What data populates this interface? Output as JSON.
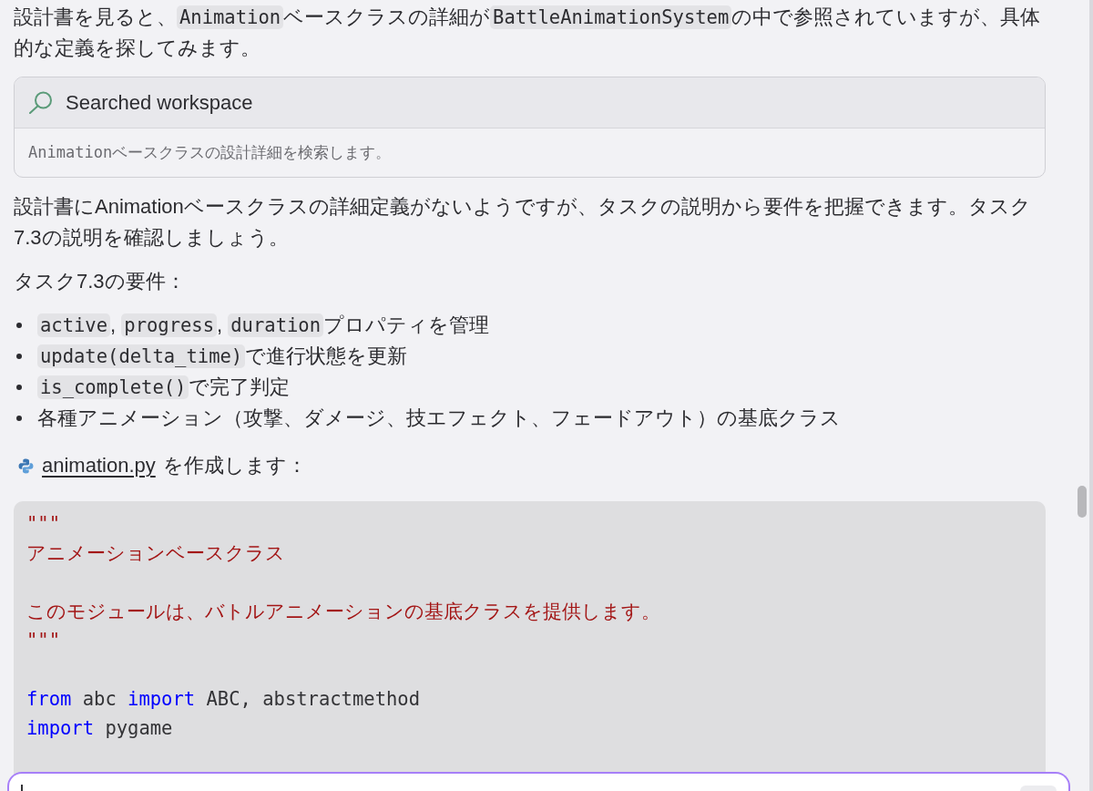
{
  "blocks": [
    {
      "kind": "paragraph",
      "segments": [
        {
          "kind": "text",
          "text": "設計書を見ると、"
        },
        {
          "kind": "code",
          "text": "Animation"
        },
        {
          "kind": "text",
          "text": "ベースクラスの詳細が"
        },
        {
          "kind": "code",
          "text": "BattleAnimationSystem"
        },
        {
          "kind": "text",
          "text": "の中で参照されていますが、具体的な定義を探してみます。"
        }
      ]
    },
    {
      "kind": "tool_card",
      "title": "Searched workspace",
      "detail": "Animationベースクラスの設計詳細を検索します。"
    },
    {
      "kind": "paragraph",
      "segments": [
        {
          "kind": "text",
          "text": "設計書にAnimationベースクラスの詳細定義がないようですが、タスクの説明から要件を把握できます。タスク7.3の説明を確認しましょう。"
        }
      ]
    },
    {
      "kind": "paragraph",
      "segments": [
        {
          "kind": "text",
          "text": "タスク7.3の要件："
        }
      ]
    },
    {
      "kind": "list",
      "items": [
        {
          "segments": [
            {
              "kind": "code",
              "text": "active"
            },
            {
              "kind": "text",
              "text": ", "
            },
            {
              "kind": "code",
              "text": "progress"
            },
            {
              "kind": "text",
              "text": ", "
            },
            {
              "kind": "code",
              "text": "duration"
            },
            {
              "kind": "text",
              "text": "プロパティを管理"
            }
          ]
        },
        {
          "segments": [
            {
              "kind": "code",
              "text": "update(delta_time)"
            },
            {
              "kind": "text",
              "text": "で進行状態を更新"
            }
          ]
        },
        {
          "segments": [
            {
              "kind": "code",
              "text": "is_complete()"
            },
            {
              "kind": "text",
              "text": "で完了判定"
            }
          ]
        },
        {
          "segments": [
            {
              "kind": "text",
              "text": "各種アニメーション（攻撃、ダメージ、技エフェクト、フェードアウト）の基底クラス"
            }
          ]
        }
      ]
    },
    {
      "kind": "file_ref",
      "link": "animation.py",
      "text": "を作成します："
    },
    {
      "kind": "code_block",
      "lines": [
        {
          "kind": "code",
          "tokens": [
            {
              "kind": "string",
              "text": "\"\"\""
            }
          ]
        },
        {
          "kind": "code",
          "tokens": [
            {
              "kind": "string",
              "text": "アニメーションベースクラス"
            }
          ]
        },
        {
          "kind": "blank"
        },
        {
          "kind": "code",
          "tokens": [
            {
              "kind": "string",
              "text": "このモジュールは、バトルアニメーションの基底クラスを提供します。"
            }
          ]
        },
        {
          "kind": "code",
          "tokens": [
            {
              "kind": "string",
              "text": "\"\"\""
            }
          ]
        },
        {
          "kind": "blank"
        },
        {
          "kind": "code",
          "tokens": [
            {
              "kind": "keyword",
              "text": "from"
            },
            {
              "kind": "plain",
              "text": " abc "
            },
            {
              "kind": "keyword",
              "text": "import"
            },
            {
              "kind": "plain",
              "text": " ABC, abstractmethod"
            }
          ]
        },
        {
          "kind": "code",
          "tokens": [
            {
              "kind": "keyword",
              "text": "import"
            },
            {
              "kind": "plain",
              "text": " pygame"
            }
          ]
        }
      ]
    }
  ],
  "composer": {
    "focused": true
  }
}
